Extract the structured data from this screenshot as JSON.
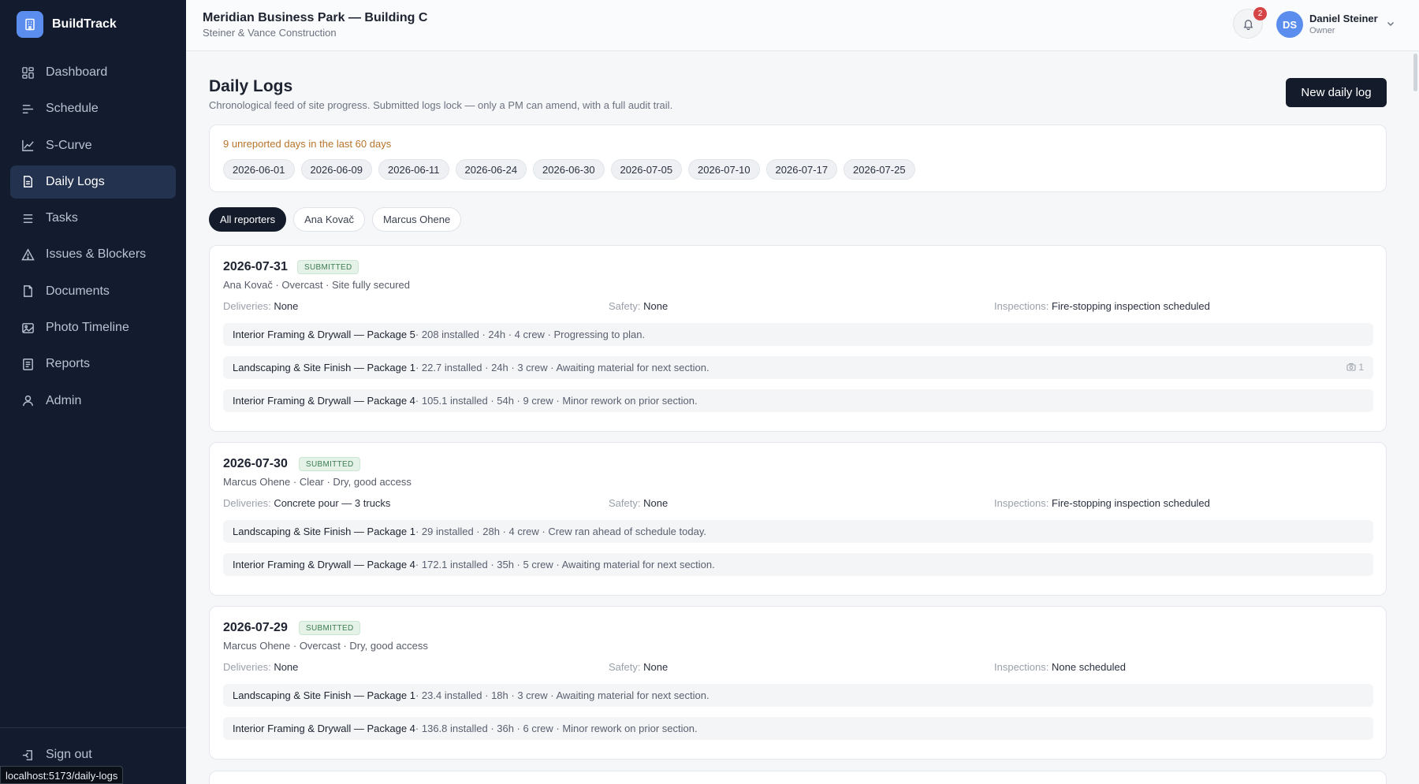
{
  "app": {
    "name": "BuildTrack",
    "logo_icon": "building-icon",
    "accent": "#5b8def"
  },
  "sidebar": {
    "items": [
      {
        "label": "Dashboard",
        "icon": "dashboard-icon"
      },
      {
        "label": "Schedule",
        "icon": "schedule-icon"
      },
      {
        "label": "S-Curve",
        "icon": "chart-line-icon"
      },
      {
        "label": "Daily Logs",
        "icon": "document-icon",
        "active": true
      },
      {
        "label": "Tasks",
        "icon": "list-icon"
      },
      {
        "label": "Issues & Blockers",
        "icon": "warning-icon"
      },
      {
        "label": "Documents",
        "icon": "file-icon"
      },
      {
        "label": "Photo Timeline",
        "icon": "image-icon"
      },
      {
        "label": "Reports",
        "icon": "report-icon"
      },
      {
        "label": "Admin",
        "icon": "user-icon"
      }
    ],
    "signout_label": "Sign out"
  },
  "status_url": "localhost:5173/daily-logs",
  "header": {
    "project_title": "Meridian Business Park — Building C",
    "company": "Steiner & Vance Construction",
    "notification_count": "2",
    "user": {
      "initials": "DS",
      "name": "Daniel Steiner",
      "role": "Owner"
    }
  },
  "page": {
    "title": "Daily Logs",
    "description": "Chronological feed of site progress. Submitted logs lock — only a PM can amend, with a full audit trail.",
    "new_button": "New daily log"
  },
  "unreported": {
    "label": "9 unreported days in the last 60 days",
    "dates": [
      "2026-06-01",
      "2026-06-09",
      "2026-06-11",
      "2026-06-24",
      "2026-06-30",
      "2026-07-05",
      "2026-07-10",
      "2026-07-17",
      "2026-07-25"
    ]
  },
  "filters": [
    "All reporters",
    "Ana Kovač",
    "Marcus Ohene"
  ],
  "labels": {
    "deliveries": "Deliveries:",
    "safety": "Safety:",
    "inspections": "Inspections:"
  },
  "logs": [
    {
      "date": "2026-07-31",
      "status": "SUBMITTED",
      "meta": "Ana Kovač · Overcast · Site fully secured",
      "deliveries": "None",
      "safety": "None",
      "inspections": "Fire-stopping inspection scheduled",
      "entries": [
        {
          "package": "Interior Framing & Drywall — Package 5",
          "detail": " · 208 installed · 24h · 4 crew · Progressing to plan."
        },
        {
          "package": "Landscaping & Site Finish — Package 1",
          "detail": " · 22.7 installed · 24h · 3 crew · Awaiting material for next section.",
          "photos": "1"
        },
        {
          "package": "Interior Framing & Drywall — Package 4",
          "detail": " · 105.1 installed · 54h · 9 crew · Minor rework on prior section."
        }
      ]
    },
    {
      "date": "2026-07-30",
      "status": "SUBMITTED",
      "meta": "Marcus Ohene · Clear · Dry, good access",
      "deliveries": "Concrete pour — 3 trucks",
      "safety": "None",
      "inspections": "Fire-stopping inspection scheduled",
      "entries": [
        {
          "package": "Landscaping & Site Finish — Package 1",
          "detail": " · 29 installed · 28h · 4 crew · Crew ran ahead of schedule today."
        },
        {
          "package": "Interior Framing & Drywall — Package 4",
          "detail": " · 172.1 installed · 35h · 5 crew · Awaiting material for next section."
        }
      ]
    },
    {
      "date": "2026-07-29",
      "status": "SUBMITTED",
      "meta": "Marcus Ohene · Overcast · Dry, good access",
      "deliveries": "None",
      "safety": "None",
      "inspections": "None scheduled",
      "entries": [
        {
          "package": "Landscaping & Site Finish — Package 1",
          "detail": " · 23.4 installed · 18h · 3 crew · Awaiting material for next section."
        },
        {
          "package": "Interior Framing & Drywall — Package 4",
          "detail": " · 136.8 installed · 36h · 6 crew · Minor rework on prior section."
        }
      ]
    }
  ]
}
